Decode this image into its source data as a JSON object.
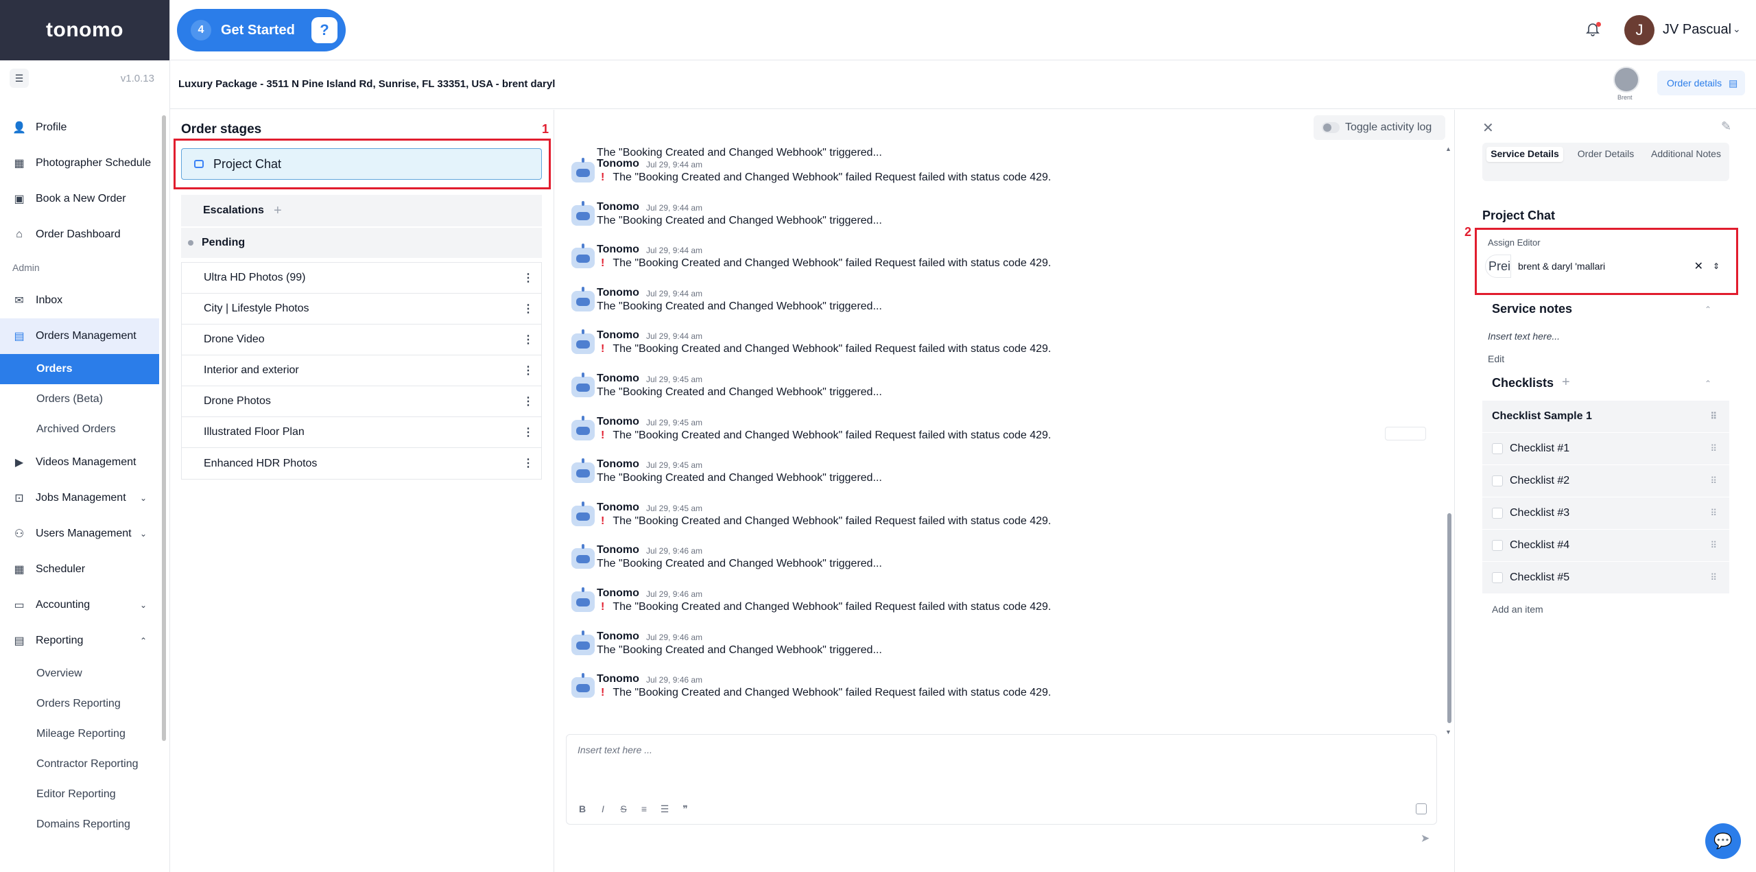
{
  "brand": {
    "logo": "tonomo",
    "version": "v1.0.13"
  },
  "nav": {
    "items": [
      {
        "key": "profile",
        "label": "Profile",
        "icon": "user-icon"
      },
      {
        "key": "photographer-schedule",
        "label": "Photographer Schedule",
        "icon": "calendar-icon"
      },
      {
        "key": "book-order",
        "label": "Book a New Order",
        "icon": "book-icon"
      },
      {
        "key": "order-dashboard",
        "label": "Order Dashboard",
        "icon": "home-icon"
      }
    ],
    "admin_label": "Admin",
    "admin_items": [
      {
        "key": "inbox",
        "label": "Inbox"
      },
      {
        "key": "orders-management",
        "label": "Orders Management"
      },
      {
        "key": "orders",
        "label": "Orders"
      },
      {
        "key": "orders-beta",
        "label": "Orders (Beta)"
      },
      {
        "key": "archived-orders",
        "label": "Archived Orders"
      },
      {
        "key": "videos-management",
        "label": "Videos Management"
      },
      {
        "key": "jobs-management",
        "label": "Jobs Management"
      },
      {
        "key": "users-management",
        "label": "Users Management"
      },
      {
        "key": "scheduler",
        "label": "Scheduler"
      },
      {
        "key": "accounting",
        "label": "Accounting"
      },
      {
        "key": "reporting",
        "label": "Reporting"
      },
      {
        "key": "overview",
        "label": "Overview"
      },
      {
        "key": "orders-reporting",
        "label": "Orders Reporting"
      },
      {
        "key": "mileage-reporting",
        "label": "Mileage Reporting"
      },
      {
        "key": "contractor-reporting",
        "label": "Contractor Reporting"
      },
      {
        "key": "editor-reporting",
        "label": "Editor Reporting"
      },
      {
        "key": "domains-reporting",
        "label": "Domains Reporting"
      }
    ]
  },
  "header": {
    "get_started_count": "4",
    "get_started_label": "Get Started",
    "user_initial": "J",
    "user_name": "JV Pascual"
  },
  "order": {
    "title": "Luxury Package - 3511 N Pine Island Rd, Sunrise, FL 33351, USA - brent daryl",
    "avatar_label": "Brent",
    "details_button": "Order details"
  },
  "stages": {
    "title": "Order stages",
    "project_chat": "Project Chat",
    "escalations": "Escalations",
    "pending": "Pending",
    "marker1": "1",
    "list": [
      "Ultra HD Photos (99)",
      "City | Lifestyle Photos",
      "Drone Video",
      "Interior and exterior",
      "Drone Photos",
      "Illustrated Floor Plan",
      "Enhanced HDR Photos"
    ]
  },
  "chat": {
    "toggle_label": "Toggle activity log",
    "composer_placeholder": "Insert text here ...",
    "sender": "Tonomo",
    "triggered_text": "The \"Booking Created and Changed Webhook\" triggered...",
    "failed_text": "The \"Booking Created and Changed Webhook\" failed Request failed with status code 429.",
    "messages": [
      {
        "time": "Jul 29, 9:44 am",
        "type": "failed"
      },
      {
        "time": "Jul 29, 9:44 am",
        "type": "triggered"
      },
      {
        "time": "Jul 29, 9:44 am",
        "type": "failed"
      },
      {
        "time": "Jul 29, 9:44 am",
        "type": "triggered"
      },
      {
        "time": "Jul 29, 9:44 am",
        "type": "failed"
      },
      {
        "time": "Jul 29, 9:45 am",
        "type": "triggered"
      },
      {
        "time": "Jul 29, 9:45 am",
        "type": "failed"
      },
      {
        "time": "Jul 29, 9:45 am",
        "type": "triggered"
      },
      {
        "time": "Jul 29, 9:45 am",
        "type": "failed"
      },
      {
        "time": "Jul 29, 9:46 am",
        "type": "triggered"
      },
      {
        "time": "Jul 29, 9:46 am",
        "type": "failed"
      },
      {
        "time": "Jul 29, 9:46 am",
        "type": "triggered"
      },
      {
        "time": "Jul 29, 9:46 am",
        "type": "failed"
      }
    ]
  },
  "right": {
    "tabs": [
      "Service Details",
      "Order Details",
      "Additional Notes"
    ],
    "section_title": "Project Chat",
    "marker2": "2",
    "assign_label": "Assign Editor",
    "assign_prefix": "Prei",
    "assign_value": "brent & daryl 'mallari",
    "service_notes": "Service notes",
    "notes_placeholder": "Insert text here...",
    "edit": "Edit",
    "checklists": "Checklists",
    "checklist_name": "Checklist Sample 1",
    "checklist_items": [
      "Checklist #1",
      "Checklist #2",
      "Checklist #3",
      "Checklist #4",
      "Checklist #5"
    ],
    "add_item": "Add an item"
  }
}
